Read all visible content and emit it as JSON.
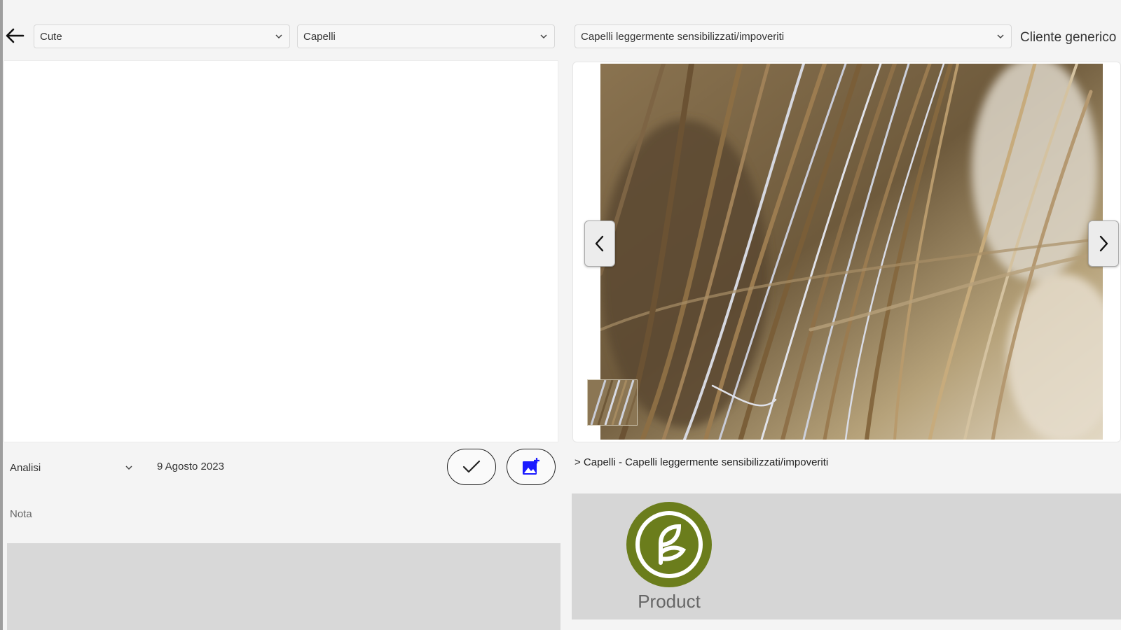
{
  "header": {
    "area_select": "Cute",
    "category_select": "Capelli",
    "condition_select": "Capelli leggermente sensibilizzati/impoveriti",
    "client_label": "Cliente generico"
  },
  "analysis": {
    "type_select": "Analisi",
    "date": "9 Agosto 2023",
    "note_label": "Nota"
  },
  "gallery": {
    "breadcrumb": "> Capelli - Capelli leggermente sensibilizzati/impoveriti"
  },
  "product": {
    "name": "Product",
    "logo_color": "#6b7d1c"
  },
  "icons": {
    "back": "arrow-left-icon",
    "confirm": "checkmark-icon",
    "add_photo": "add-photo-icon",
    "prev": "chevron-left-icon",
    "next": "chevron-right-icon",
    "dropdown": "chevron-down-icon"
  }
}
